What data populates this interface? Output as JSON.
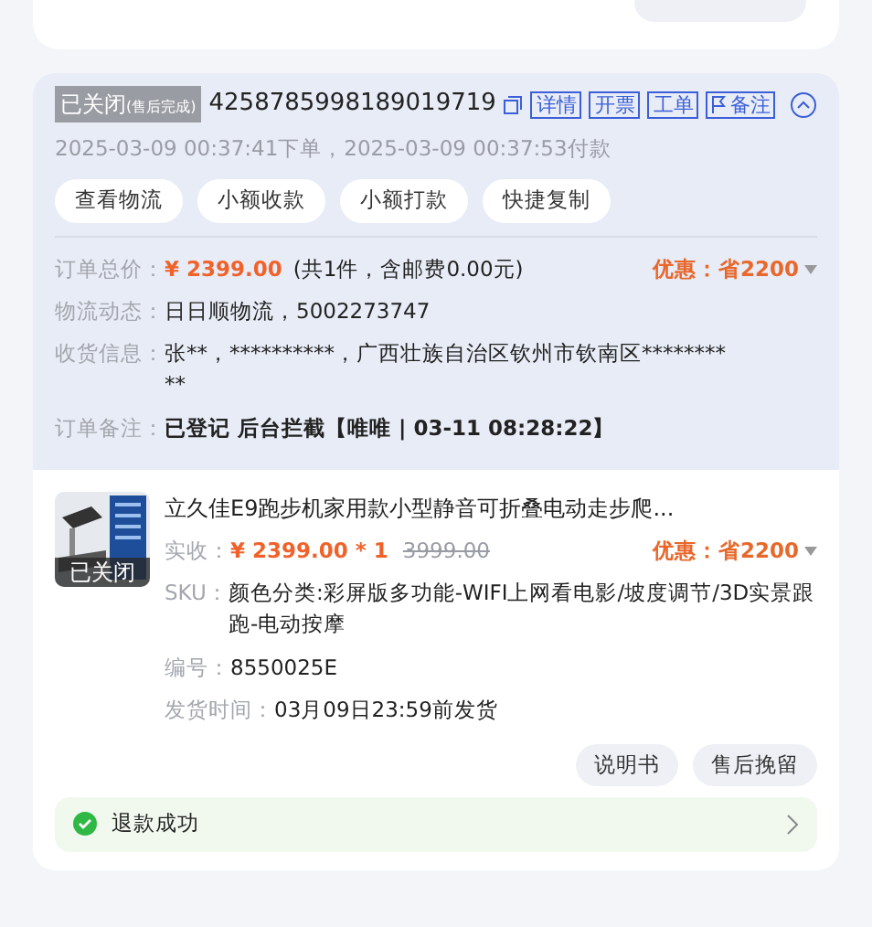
{
  "order": {
    "status": "已关闭",
    "status_note": "(售后完成)",
    "order_no": "4258785998189019719",
    "expanded": true,
    "links": [
      {
        "label": "详情",
        "kind": "plain"
      },
      {
        "label": "开票",
        "kind": "plain"
      },
      {
        "label": "工单",
        "kind": "plain"
      },
      {
        "label": "备注",
        "kind": "flag"
      }
    ],
    "times": "2025-03-09 00:37:41下单，2025-03-09 00:37:53付款",
    "actions": [
      "查看物流",
      "小额收款",
      "小额打款",
      "快捷复制"
    ],
    "total": {
      "label": "订单总价：",
      "price": "¥ 2399.00",
      "detail": "(共1件，含邮费0.00元)",
      "discount": "优惠：省2200"
    },
    "info": [
      {
        "label": "物流动态：",
        "value": "日日顺物流，5002273747",
        "bold": false
      },
      {
        "label": "收货信息：",
        "value": "张**，**********，广西壮族自治区钦州市钦南区**********",
        "bold": false
      },
      {
        "label": "订单备注：",
        "value": "已登记 后台拦截【唯唯 | 03-11 08:28:22】",
        "bold": true
      }
    ]
  },
  "product": {
    "image_badge": "已关闭",
    "title": "立久佳E9跑步机家用款小型静音可折叠电动走步爬...",
    "price_label": "实收：",
    "price": "¥ 2399.00 * 1",
    "original_price": "3999.00",
    "discount": "优惠：省2200",
    "fields": [
      {
        "label": "SKU：",
        "value": "颜色分类:彩屏版多功能-WIFI上网看电影/坡度调节/3D实景跟跑-电动按摩"
      },
      {
        "label": "编号：",
        "value": "8550025E"
      },
      {
        "label": "发货时间：",
        "value": "03月09日23:59前发货"
      }
    ],
    "buttons": [
      "说明书",
      "售后挽留"
    ],
    "refund_status": "退款成功"
  }
}
